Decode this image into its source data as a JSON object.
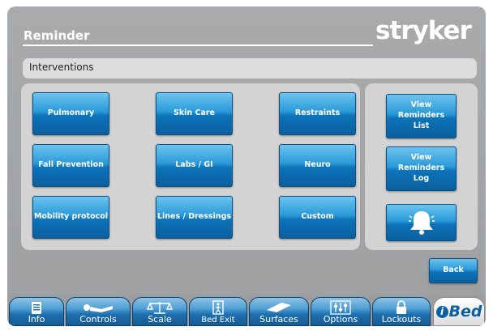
{
  "header": {
    "title": "Reminder",
    "logo": "stryker"
  },
  "section": {
    "title": "Interventions"
  },
  "interventions": [
    "Pulmonary",
    "Skin Care",
    "Restraints",
    "Fall Prevention",
    "Labs / GI",
    "Neuro",
    "Mobility protocol",
    "Lines / Dressings",
    "Custom"
  ],
  "side_buttons": {
    "view_list": "View\nReminders\nList",
    "view_log": "View\nReminders\nLog",
    "bell_icon": "bell-icon"
  },
  "back": "Back",
  "tabs": [
    {
      "label": "Info",
      "icon": "info-icon"
    },
    {
      "label": "Controls",
      "icon": "patient-icon"
    },
    {
      "label": "Scale",
      "icon": "scale-icon"
    },
    {
      "label": "Bed Exit",
      "icon": "bed-exit-icon"
    },
    {
      "label": "Surfaces",
      "icon": "surface-icon"
    },
    {
      "label": "Options",
      "icon": "sliders-icon"
    },
    {
      "label": "Lockouts",
      "icon": "lock-icon"
    }
  ],
  "brand_tab": {
    "i": "i",
    "text": "Bed"
  },
  "colors": {
    "button_blue": "#0d73b9",
    "background": "#a3a4a6",
    "panel": "#d3d3d3"
  }
}
